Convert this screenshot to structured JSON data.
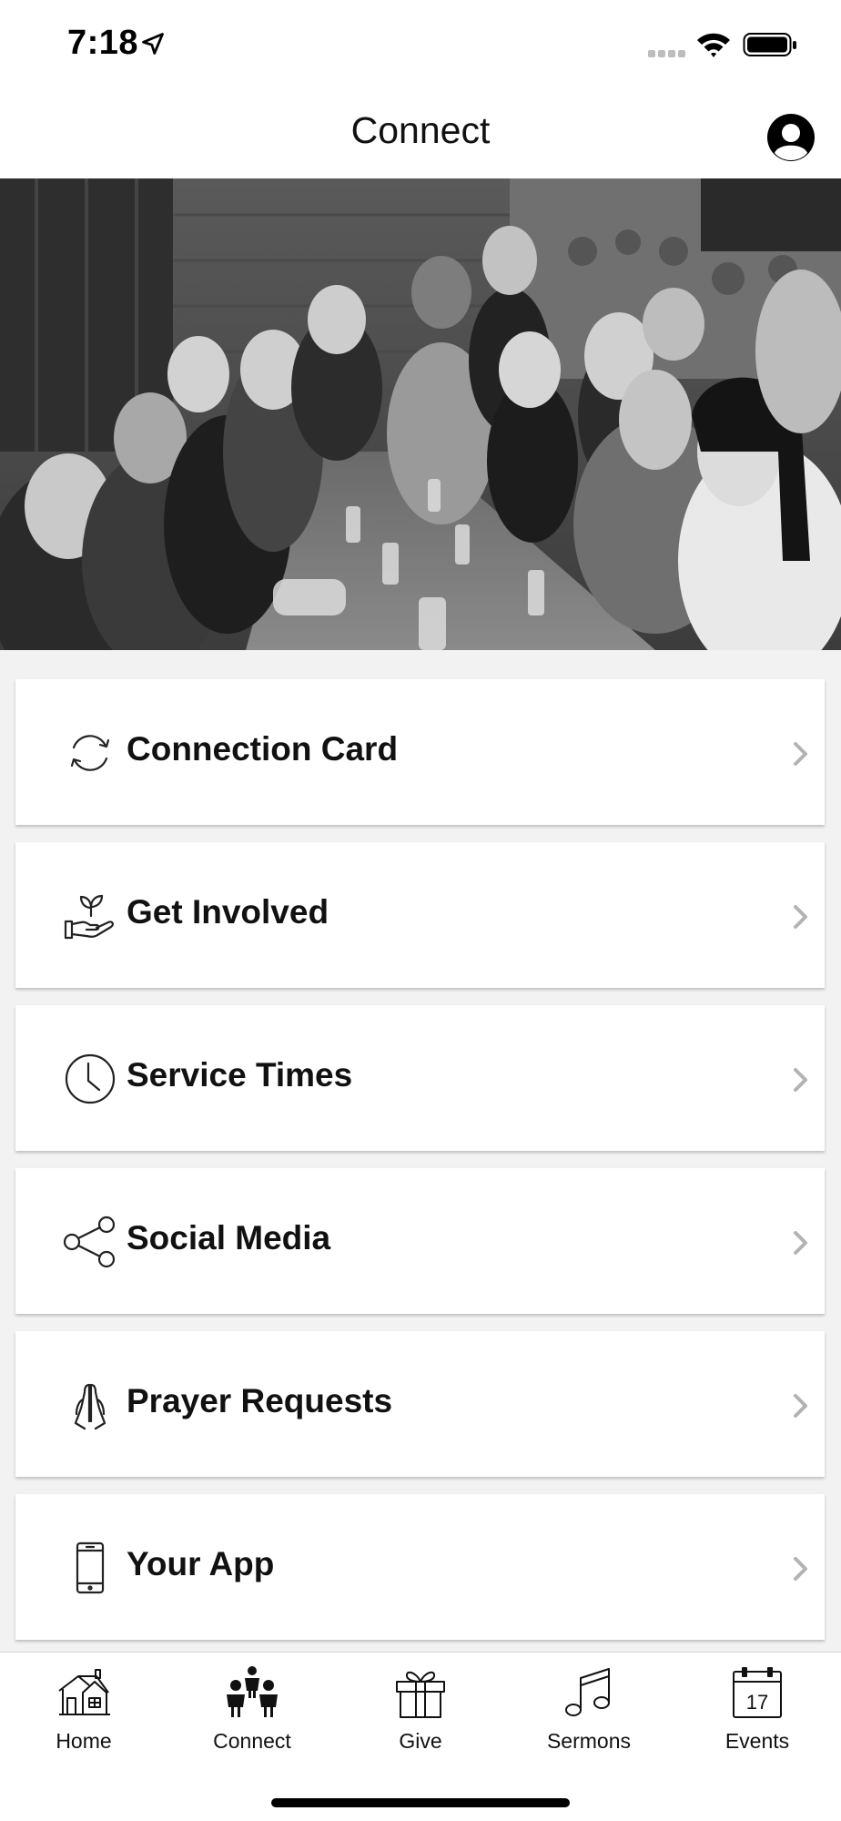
{
  "status_bar": {
    "time": "7:18"
  },
  "header": {
    "title": "Connect"
  },
  "menu": [
    {
      "label": "Connection Card",
      "icon": "sync-arrows-icon"
    },
    {
      "label": "Get Involved",
      "icon": "hand-sprout-icon"
    },
    {
      "label": "Service Times",
      "icon": "clock-icon"
    },
    {
      "label": "Social Media",
      "icon": "share-icon"
    },
    {
      "label": "Prayer Requests",
      "icon": "praying-hands-icon"
    },
    {
      "label": "Your App",
      "icon": "smartphone-icon"
    }
  ],
  "tabs": [
    {
      "label": "Home",
      "icon": "house-icon",
      "active": false
    },
    {
      "label": "Connect",
      "icon": "people-icon",
      "active": true
    },
    {
      "label": "Give",
      "icon": "gift-icon",
      "active": false
    },
    {
      "label": "Sermons",
      "icon": "music-note-icon",
      "active": false
    },
    {
      "label": "Events",
      "icon": "calendar-icon",
      "active": false
    }
  ],
  "calendar_day": "17",
  "colors": {
    "text": "#111111",
    "background": "#f2f2f2",
    "card": "#ffffff",
    "chevron": "#b3b3b3"
  }
}
